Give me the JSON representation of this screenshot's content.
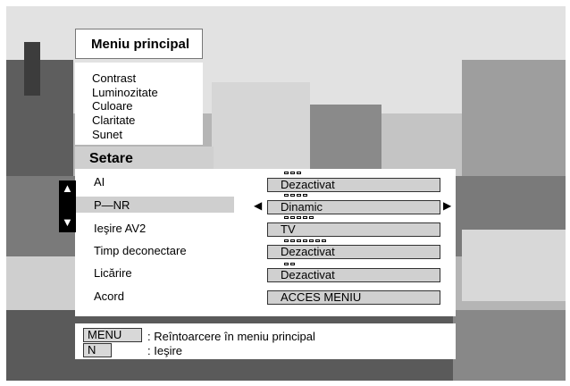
{
  "main_menu": {
    "title": "Meniu principal",
    "items": [
      "Contrast",
      "Luminozitate",
      "Culoare",
      "Claritate",
      "Sunet"
    ]
  },
  "submenu": {
    "title": "Setare",
    "rows": [
      {
        "label": "AI",
        "value": "Dezactivat",
        "indicator_count": 3,
        "selected": false
      },
      {
        "label": "P—NR",
        "value": "Dinamic",
        "indicator_count": 4,
        "selected": true
      },
      {
        "label": "Ieşire AV2",
        "value": "TV",
        "indicator_count": 5,
        "selected": false
      },
      {
        "label": "Timp deconectare",
        "value": "Dezactivat",
        "indicator_count": 7,
        "selected": false
      },
      {
        "label": "Licărire",
        "value": "Dezactivat",
        "indicator_count": 2,
        "selected": false
      },
      {
        "label": "Acord",
        "value": "ACCES MENIU",
        "indicator_count": 0,
        "selected": false
      }
    ]
  },
  "scroll": {
    "up": "▲",
    "down": "▼"
  },
  "selection_arrows": {
    "left": "◀",
    "right": "▶"
  },
  "help": {
    "menu_key": "MENU",
    "menu_text": ": Reîntoarcere în meniu principal",
    "n_key": "N",
    "n_text": ": Ieşire"
  }
}
